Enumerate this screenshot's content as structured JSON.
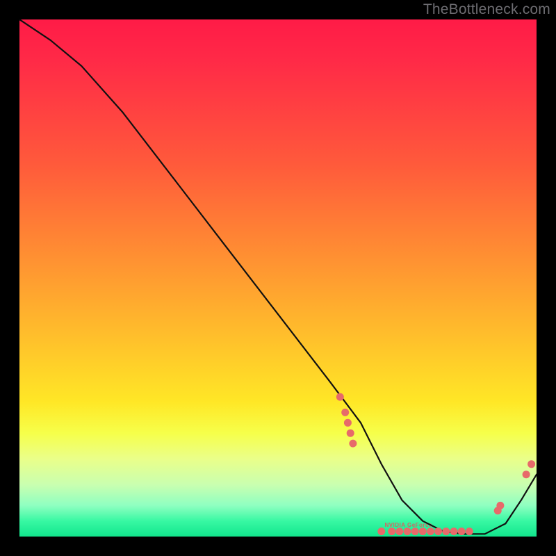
{
  "watermark": "TheBottleneck.com",
  "chart_data": {
    "type": "line",
    "title": "",
    "xlabel": "",
    "ylabel": "",
    "xlim": [
      0,
      100
    ],
    "ylim": [
      0,
      100
    ],
    "grid": false,
    "legend": false,
    "background_gradient": [
      "#ff1b47",
      "#ff8a33",
      "#ffe726",
      "#11e58c"
    ],
    "series": [
      {
        "name": "bottleneck-curve",
        "x": [
          0,
          6,
          12,
          20,
          30,
          40,
          50,
          60,
          66,
          70,
          74,
          78,
          82,
          86,
          90,
          94,
          97,
          100
        ],
        "y": [
          100,
          96,
          91,
          82,
          69,
          56,
          43,
          30,
          22,
          14,
          7,
          3,
          1,
          0.5,
          0.5,
          2.5,
          7,
          12
        ]
      }
    ],
    "markers": {
      "name": "highlighted-points",
      "color": "#e76a6a",
      "points": [
        {
          "x": 62,
          "y": 27
        },
        {
          "x": 63,
          "y": 24
        },
        {
          "x": 63.5,
          "y": 22
        },
        {
          "x": 64,
          "y": 20
        },
        {
          "x": 64.5,
          "y": 18
        },
        {
          "x": 70,
          "y": 1
        },
        {
          "x": 72,
          "y": 1
        },
        {
          "x": 73.5,
          "y": 1
        },
        {
          "x": 75,
          "y": 1
        },
        {
          "x": 76.5,
          "y": 1
        },
        {
          "x": 78,
          "y": 1
        },
        {
          "x": 79.5,
          "y": 1
        },
        {
          "x": 81,
          "y": 1
        },
        {
          "x": 82.5,
          "y": 1
        },
        {
          "x": 84,
          "y": 1
        },
        {
          "x": 85.5,
          "y": 1
        },
        {
          "x": 87,
          "y": 1
        },
        {
          "x": 92.5,
          "y": 5
        },
        {
          "x": 93,
          "y": 6
        },
        {
          "x": 98,
          "y": 12
        },
        {
          "x": 99,
          "y": 14
        }
      ]
    },
    "annotations": [
      {
        "text": "NVIDIA GeForce",
        "x": 76,
        "y": 1.8
      }
    ]
  }
}
